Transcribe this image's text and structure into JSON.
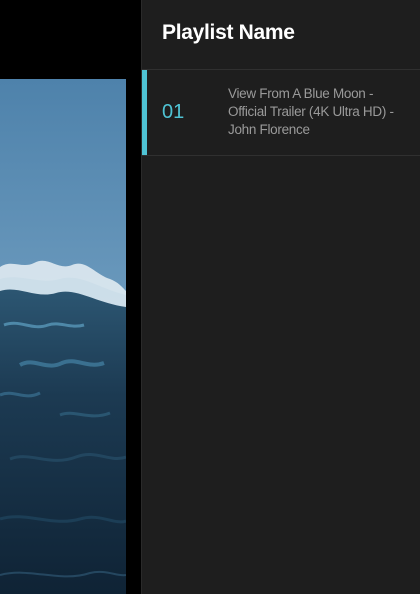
{
  "playlist": {
    "title": "Playlist Name",
    "items": [
      {
        "index": "01",
        "title": "View From A Blue Moon - Official Trailer (4K Ultra HD) - John Florence",
        "active": true
      }
    ]
  },
  "colors": {
    "accent": "#4fc3d4",
    "panel_background": "#1e1e1e",
    "page_background": "#000000"
  },
  "video": {
    "thumbnail": "ocean-wave-image"
  }
}
